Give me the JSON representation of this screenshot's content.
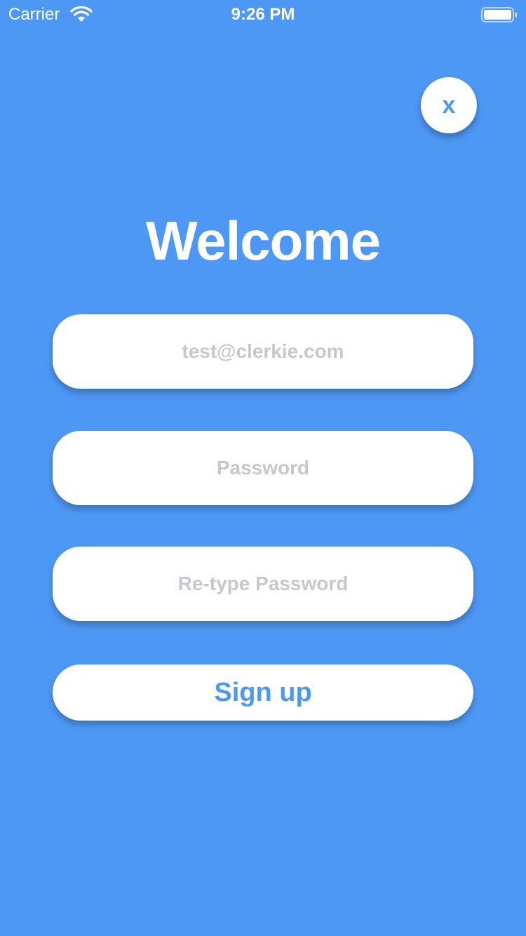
{
  "status_bar": {
    "carrier": "Carrier",
    "time": "9:26 PM",
    "icons": [
      "wifi-icon",
      "battery-icon"
    ]
  },
  "close_button": {
    "label": "x",
    "icon": "close-icon"
  },
  "title": "Welcome",
  "form": {
    "email": {
      "value": "",
      "placeholder": "test@clerkie.com"
    },
    "password": {
      "value": "",
      "placeholder": "Password"
    },
    "retype_password": {
      "value": "",
      "placeholder": "Re-type Password"
    },
    "signup_label": "Sign up"
  },
  "colors": {
    "background": "#4e98f5",
    "accent": "#4e98f5",
    "field_background": "#ffffff",
    "placeholder": "#c7c7cc"
  }
}
